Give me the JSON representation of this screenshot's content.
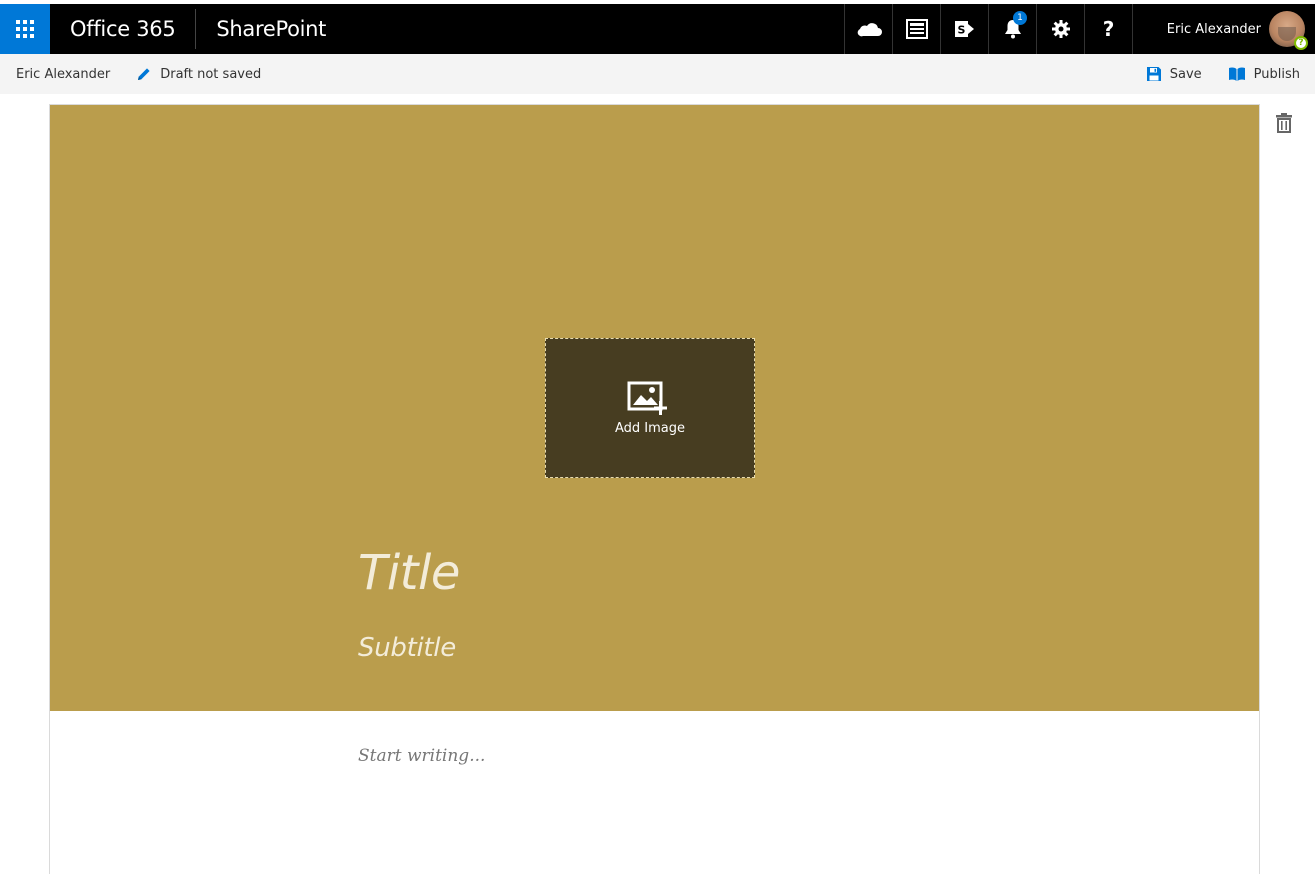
{
  "suite_bar": {
    "brand": "Office 365",
    "app_name": "SharePoint",
    "notification_count": "1",
    "help_label": "?",
    "user_name": "Eric Alexander",
    "presence_symbol": "?",
    "icons": [
      "waffle-icon",
      "onedrive-cloud-icon",
      "newsfeed-icon",
      "sites-icon",
      "notifications-bell-icon",
      "settings-gear-icon",
      "help-icon"
    ],
    "colors": {
      "bar": "#000000",
      "waffle": "#0078d7",
      "badge": "#0078d7",
      "presence": "#7fba00"
    }
  },
  "command_bar": {
    "author": "Eric Alexander",
    "draft_status": "Draft not saved",
    "save_label": "Save",
    "publish_label": "Publish",
    "colors": {
      "background": "#f4f4f4",
      "icon_accent": "#0078d7"
    }
  },
  "hero": {
    "add_image_label": "Add Image",
    "title_placeholder": "Title",
    "subtitle_placeholder": "Subtitle",
    "colors": {
      "background": "#ba9d4c",
      "add_image_box": "#473d21"
    }
  },
  "body": {
    "start_writing_placeholder": "Start writing..."
  }
}
